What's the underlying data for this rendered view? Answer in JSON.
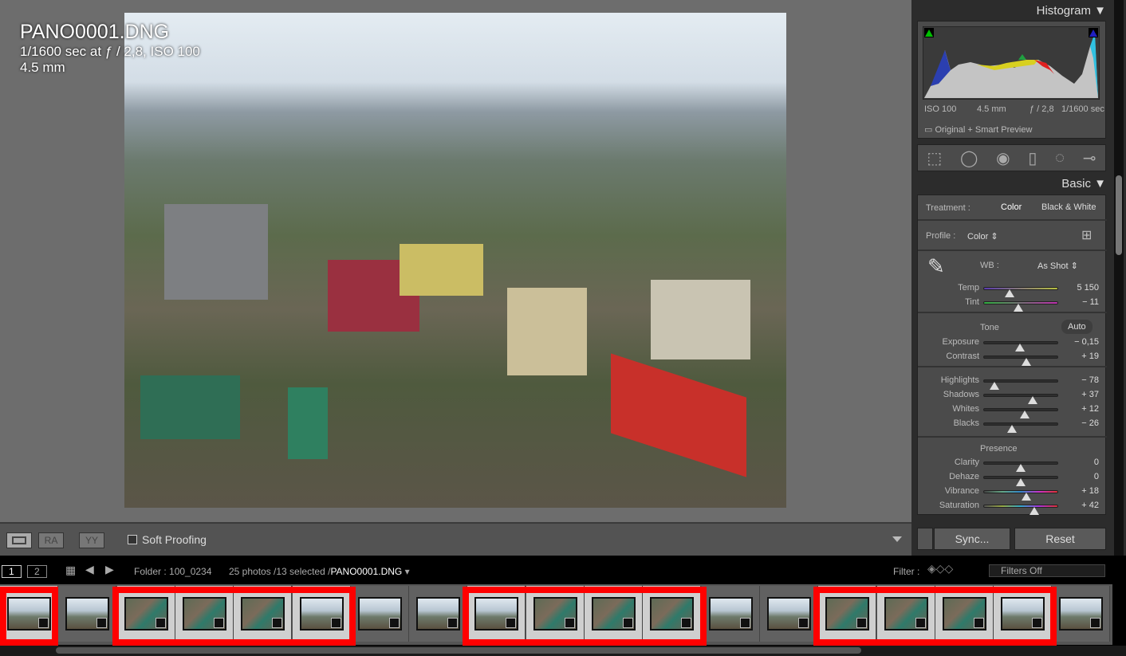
{
  "photo_info": {
    "filename": "PANO0001.DNG",
    "exposure_line": "1/1600 sec at ƒ / 2,8, ISO 100",
    "focal": "4.5 mm"
  },
  "toolbar": {
    "view_icons": [
      "loupe-view-icon",
      "before-after-ra-icon",
      "before-after-yy-icon"
    ],
    "ra": "RA",
    "yy": "YY",
    "soft_proofing": "Soft Proofing",
    "soft_proofing_checked": false
  },
  "histogram": {
    "title": "Histogram",
    "iso": "ISO 100",
    "focal": "4.5 mm",
    "aperture": "ƒ / 2,8",
    "shutter": "1/1600 sec",
    "preview": "Original + Smart Preview",
    "colors": {
      "shadow_clip": "#00c000",
      "highlight_clip": "#2020c0"
    }
  },
  "tools": [
    "crop-overlay-icon",
    "spot-removal-icon",
    "red-eye-icon",
    "graduated-filter-icon",
    "radial-filter-icon",
    "adjustment-brush-icon"
  ],
  "basic": {
    "title": "Basic",
    "treatment_label": "Treatment :",
    "treatment_color": "Color",
    "treatment_bw": "Black & White",
    "profile_label": "Profile :",
    "profile_value": "Color ⇕",
    "wb_label": "WB :",
    "wb_value": "As Shot ⇕",
    "wb": [
      {
        "name": "Temp",
        "value": "5 150",
        "pos": 35
      },
      {
        "name": "Tint",
        "value": "− 11",
        "pos": 47
      }
    ],
    "tone_label": "Tone",
    "auto": "Auto",
    "tone": [
      {
        "name": "Exposure",
        "value": "− 0,15",
        "pos": 49
      },
      {
        "name": "Contrast",
        "value": "+ 19",
        "pos": 58
      }
    ],
    "tone2": [
      {
        "name": "Highlights",
        "value": "− 78",
        "pos": 14
      },
      {
        "name": "Shadows",
        "value": "+ 37",
        "pos": 66
      },
      {
        "name": "Whites",
        "value": "+ 12",
        "pos": 55
      },
      {
        "name": "Blacks",
        "value": "− 26",
        "pos": 38
      }
    ],
    "presence_label": "Presence",
    "presence": [
      {
        "name": "Clarity",
        "value": "0",
        "pos": 50
      },
      {
        "name": "Dehaze",
        "value": "0",
        "pos": 50
      },
      {
        "name": "Vibrance",
        "value": "+ 18",
        "pos": 58
      },
      {
        "name": "Saturation",
        "value": "+ 42",
        "pos": 68
      }
    ]
  },
  "panel_buttons": {
    "sync": "Sync...",
    "reset": "Reset"
  },
  "filmstrip": {
    "screen1": "1",
    "screen2": "2",
    "folder": "Folder : 100_0234",
    "count": "25 photos /13 selected /",
    "current": "PANO0001.DNG",
    "filter_label": "Filter :",
    "filter_value": "Filters Off",
    "cells": [
      {
        "sel": true,
        "aerial": false
      },
      {
        "sel": false,
        "aerial": false
      },
      {
        "sel": true,
        "aerial": true
      },
      {
        "sel": true,
        "aerial": true
      },
      {
        "sel": true,
        "aerial": true
      },
      {
        "sel": true,
        "aerial": false
      },
      {
        "sel": false,
        "aerial": false
      },
      {
        "sel": false,
        "aerial": false
      },
      {
        "sel": true,
        "aerial": false
      },
      {
        "sel": true,
        "aerial": true
      },
      {
        "sel": true,
        "aerial": true
      },
      {
        "sel": true,
        "aerial": true
      },
      {
        "sel": false,
        "aerial": false
      },
      {
        "sel": false,
        "aerial": false
      },
      {
        "sel": true,
        "aerial": true
      },
      {
        "sel": true,
        "aerial": true
      },
      {
        "sel": true,
        "aerial": true
      },
      {
        "sel": true,
        "aerial": false
      },
      {
        "sel": false,
        "aerial": false
      }
    ],
    "highlight_color": "#ff0000"
  }
}
